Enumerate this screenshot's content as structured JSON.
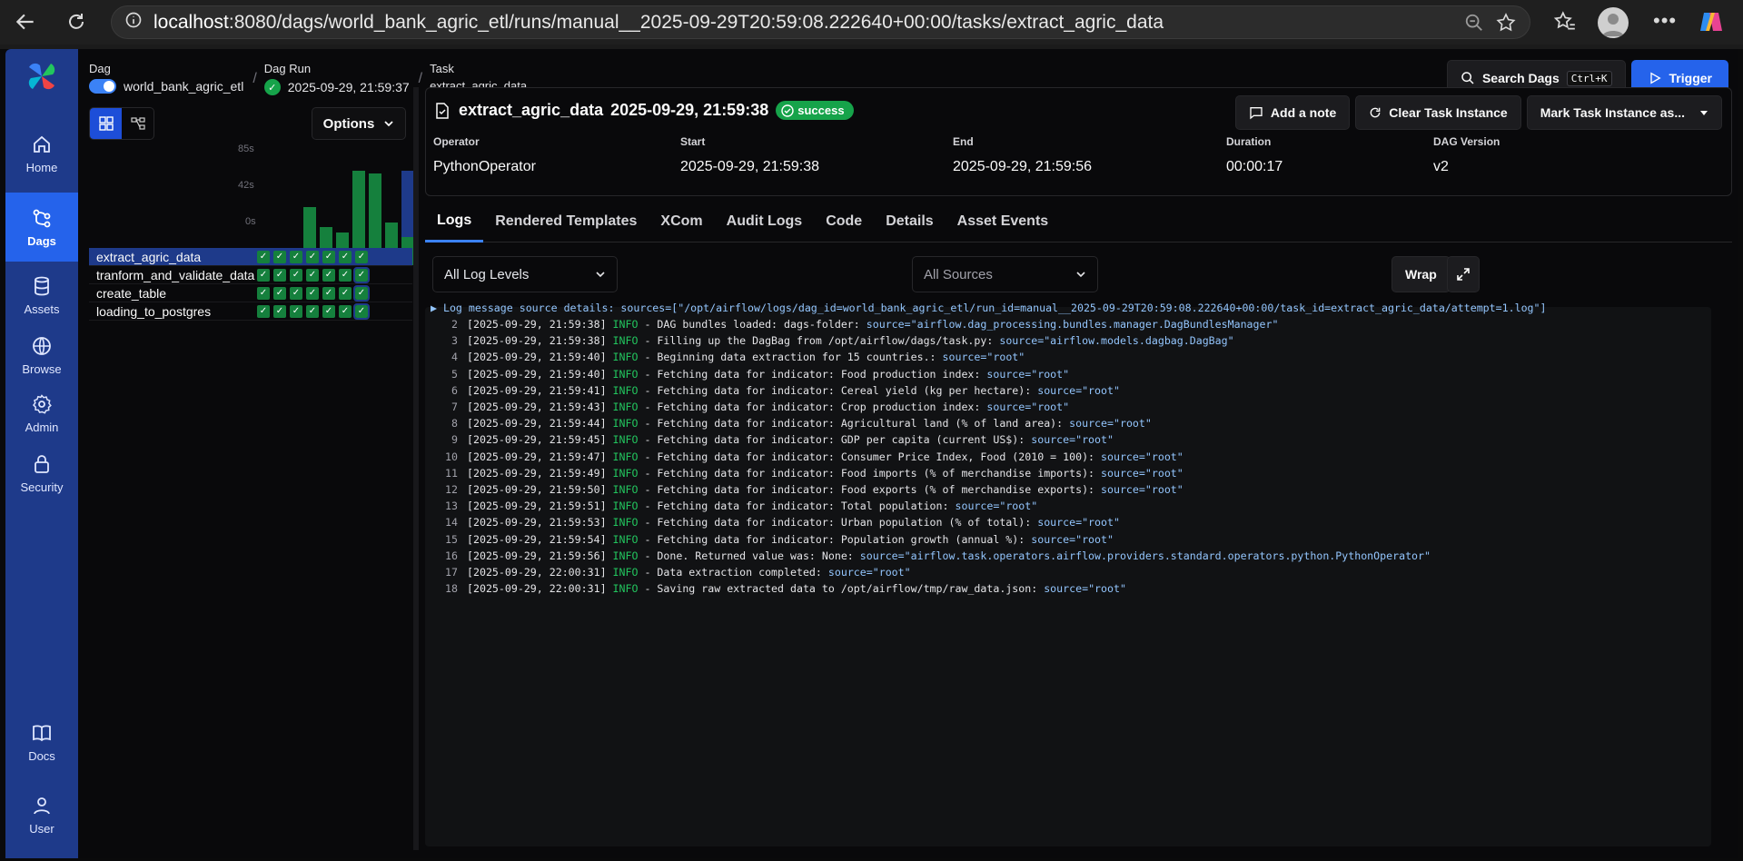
{
  "browser": {
    "url_host": "localhost",
    "url_rest": ":8080/dags/world_bank_agric_etl/runs/manual__2025-09-29T20:59:08.222640+00:00/tasks/extract_agric_data"
  },
  "nav": {
    "items": [
      {
        "label": "Home",
        "icon": "home-icon"
      },
      {
        "label": "Dags",
        "icon": "dags-icon"
      },
      {
        "label": "Assets",
        "icon": "assets-icon"
      },
      {
        "label": "Browse",
        "icon": "browse-icon"
      },
      {
        "label": "Admin",
        "icon": "gear-icon"
      },
      {
        "label": "Security",
        "icon": "lock-icon"
      },
      {
        "label": "Docs",
        "icon": "book-icon"
      },
      {
        "label": "User",
        "icon": "user-icon"
      }
    ]
  },
  "breadcrumb": {
    "dag_label": "Dag",
    "dag_value": "world_bank_agric_etl",
    "run_label": "Dag Run",
    "run_value": "2025-09-29, 21:59:37",
    "task_label": "Task",
    "task_value": "extract_agric_data"
  },
  "topbar": {
    "search_label": "Search Dags",
    "search_shortcut": "Ctrl+K",
    "trigger_label": "Trigger"
  },
  "grid": {
    "options_label": "Options",
    "duration_ticks": [
      "85s",
      "42s",
      "0s"
    ],
    "run_durations_fraction": [
      0.62,
      0.4,
      0.35,
      1.0,
      0.97,
      0.45,
      1.0
    ],
    "tasks": [
      "extract_agric_data",
      "tranform_and_validate_data",
      "create_table",
      "loading_to_postgres"
    ]
  },
  "task_header": {
    "title": "extract_agric_data",
    "timestamp": "2025-09-29, 21:59:38",
    "status": "success",
    "add_note": "Add a note",
    "clear": "Clear Task Instance",
    "mark": "Mark Task Instance as...",
    "meta": [
      {
        "label": "Operator",
        "value": "PythonOperator"
      },
      {
        "label": "Start",
        "value": "2025-09-29, 21:59:38"
      },
      {
        "label": "End",
        "value": "2025-09-29, 21:59:56"
      },
      {
        "label": "Duration",
        "value": "00:00:17"
      },
      {
        "label": "DAG Version",
        "value": "v2"
      }
    ]
  },
  "tabs": [
    "Logs",
    "Rendered Templates",
    "XCom",
    "Audit Logs",
    "Code",
    "Details",
    "Asset Events"
  ],
  "log_filters": {
    "levels": "All Log Levels",
    "sources": "All Sources",
    "wrap": "Wrap"
  },
  "logs": {
    "source_details": "▶ Log message source details: sources=[\"/opt/airflow/logs/dag_id=world_bank_agric_etl/run_id=manual__2025-09-29T20:59:08.222640+00:00/task_id=extract_agric_data/attempt=1.log\"]",
    "lines": [
      {
        "n": "2",
        "ts": "[2025-09-29, 21:59:38]",
        "lvl": "INFO",
        "msg": " - DAG bundles loaded: dags-folder: ",
        "src": "source=\"airflow.dag_processing.bundles.manager.DagBundlesManager\""
      },
      {
        "n": "3",
        "ts": "[2025-09-29, 21:59:38]",
        "lvl": "INFO",
        "msg": " - Filling up the DagBag from /opt/airflow/dags/task.py: ",
        "src": "source=\"airflow.models.dagbag.DagBag\""
      },
      {
        "n": "4",
        "ts": "[2025-09-29, 21:59:40]",
        "lvl": "INFO",
        "msg": " - Beginning data extraction for 15 countries.: ",
        "src": "source=\"root\""
      },
      {
        "n": "5",
        "ts": "[2025-09-29, 21:59:40]",
        "lvl": "INFO",
        "msg": " - Fetching data for indicator: Food production index: ",
        "src": "source=\"root\""
      },
      {
        "n": "6",
        "ts": "[2025-09-29, 21:59:41]",
        "lvl": "INFO",
        "msg": " - Fetching data for indicator: Cereal yield (kg per hectare): ",
        "src": "source=\"root\""
      },
      {
        "n": "7",
        "ts": "[2025-09-29, 21:59:43]",
        "lvl": "INFO",
        "msg": " - Fetching data for indicator: Crop production index: ",
        "src": "source=\"root\""
      },
      {
        "n": "8",
        "ts": "[2025-09-29, 21:59:44]",
        "lvl": "INFO",
        "msg": " - Fetching data for indicator: Agricultural land (% of land area): ",
        "src": "source=\"root\""
      },
      {
        "n": "9",
        "ts": "[2025-09-29, 21:59:45]",
        "lvl": "INFO",
        "msg": " - Fetching data for indicator: GDP per capita (current US$): ",
        "src": "source=\"root\""
      },
      {
        "n": "10",
        "ts": "[2025-09-29, 21:59:47]",
        "lvl": "INFO",
        "msg": " - Fetching data for indicator: Consumer Price Index, Food (2010 = 100): ",
        "src": "source=\"root\""
      },
      {
        "n": "11",
        "ts": "[2025-09-29, 21:59:49]",
        "lvl": "INFO",
        "msg": " - Fetching data for indicator: Food imports (% of merchandise imports): ",
        "src": "source=\"root\""
      },
      {
        "n": "12",
        "ts": "[2025-09-29, 21:59:50]",
        "lvl": "INFO",
        "msg": " - Fetching data for indicator: Food exports (% of merchandise exports): ",
        "src": "source=\"root\""
      },
      {
        "n": "13",
        "ts": "[2025-09-29, 21:59:51]",
        "lvl": "INFO",
        "msg": " - Fetching data for indicator: Total population: ",
        "src": "source=\"root\""
      },
      {
        "n": "14",
        "ts": "[2025-09-29, 21:59:53]",
        "lvl": "INFO",
        "msg": " - Fetching data for indicator: Urban population (% of total): ",
        "src": "source=\"root\""
      },
      {
        "n": "15",
        "ts": "[2025-09-29, 21:59:54]",
        "lvl": "INFO",
        "msg": " - Fetching data for indicator: Population growth (annual %): ",
        "src": "source=\"root\""
      },
      {
        "n": "16",
        "ts": "[2025-09-29, 21:59:56]",
        "lvl": "INFO",
        "msg": " - Done. Returned value was: None: ",
        "src": "source=\"airflow.task.operators.airflow.providers.standard.operators.python.PythonOperator\""
      },
      {
        "n": "17",
        "ts": "[2025-09-29, 22:00:31]",
        "lvl": "INFO",
        "msg": " - Data extraction completed: ",
        "src": "source=\"root\""
      },
      {
        "n": "18",
        "ts": "[2025-09-29, 22:00:31]",
        "lvl": "INFO",
        "msg": " - Saving raw extracted data to /opt/airflow/tmp/raw_data.json: ",
        "src": "source=\"root\""
      }
    ]
  },
  "colors": {
    "nav_bg": "#1e3a8a",
    "accent": "#2563eb",
    "success": "#16a34a",
    "log_level": "#22c55e",
    "log_source": "#93c5fd"
  }
}
